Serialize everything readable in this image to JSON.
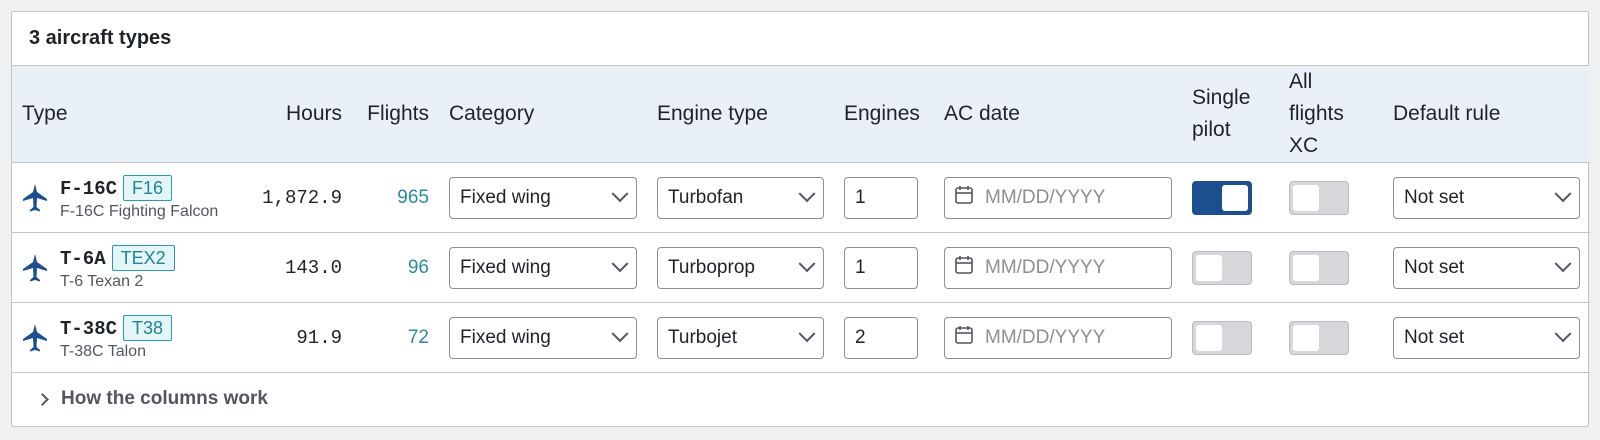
{
  "header": {
    "title": "3 aircraft types"
  },
  "columns": {
    "type": "Type",
    "hours": "Hours",
    "flights": "Flights",
    "category": "Category",
    "engine_type": "Engine type",
    "engines": "Engines",
    "ac_date": "AC date",
    "single_pilot": "Single pilot",
    "all_flights_xc": "All flights XC",
    "default_rule": "Default rule"
  },
  "rows": [
    {
      "code": "F-16C",
      "badge": "F16",
      "name": "F-16C Fighting Falcon",
      "hours": "1,872.9",
      "flights": "965",
      "category": "Fixed wing",
      "engine_type": "Turbofan",
      "engines": "1",
      "ac_date_placeholder": "MM/DD/YYYY",
      "single_pilot": true,
      "all_flights_xc": false,
      "default_rule": "Not set"
    },
    {
      "code": "T-6A",
      "badge": "TEX2",
      "name": "T-6 Texan 2",
      "hours": "143.0",
      "flights": "96",
      "category": "Fixed wing",
      "engine_type": "Turboprop",
      "engines": "1",
      "ac_date_placeholder": "MM/DD/YYYY",
      "single_pilot": false,
      "all_flights_xc": false,
      "default_rule": "Not set"
    },
    {
      "code": "T-38C",
      "badge": "T38",
      "name": "T-38C Talon",
      "hours": "91.9",
      "flights": "72",
      "category": "Fixed wing",
      "engine_type": "Turbojet",
      "engines": "2",
      "ac_date_placeholder": "MM/DD/YYYY",
      "single_pilot": false,
      "all_flights_xc": false,
      "default_rule": "Not set"
    }
  ],
  "footer": {
    "label": "How the columns work"
  },
  "icons": {
    "plane": "airplane-icon",
    "calendar": "calendar-icon",
    "chevron": "chevron-down-icon"
  },
  "colors": {
    "accent": "#1c4f8f",
    "badge": "#2a9aa8",
    "header_bg": "#eaf0f8"
  }
}
